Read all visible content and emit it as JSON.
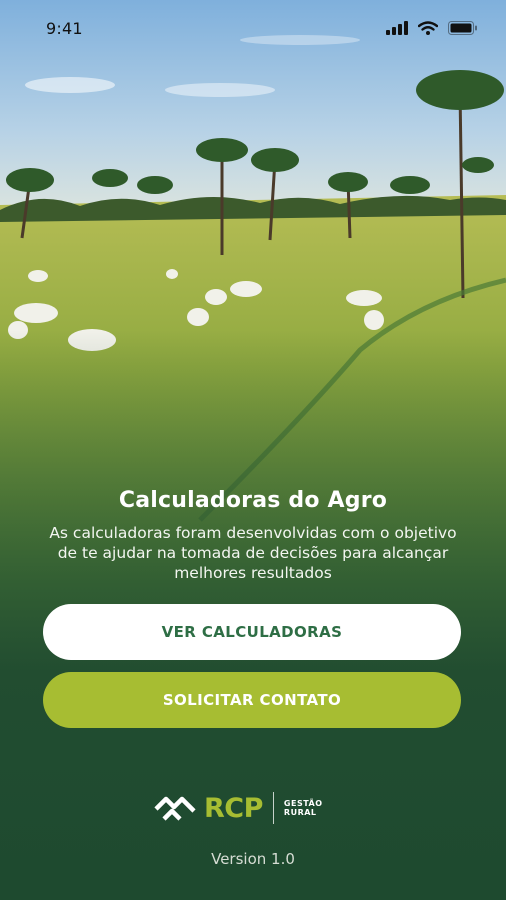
{
  "status_bar": {
    "time": "9:41",
    "icons": [
      "cellular-signal-icon",
      "wifi-icon",
      "battery-icon"
    ]
  },
  "hero": {
    "title": "Calculadoras do Agro",
    "subtitle": "As calculadoras foram desenvolvidas com o objetivo de te ajudar na tomada de decisões para alcançar melhores resultados"
  },
  "actions": {
    "primary_label": "VER CALCULADORAS",
    "secondary_label": "SOLICITAR CONTATO"
  },
  "brand": {
    "name": "RCP",
    "tagline_line1": "GESTÃO",
    "tagline_line2": "RURAL",
    "accent_color": "#a7bd32",
    "primary_text_color": "#2e6e45"
  },
  "footer": {
    "version": "Version 1.0"
  }
}
